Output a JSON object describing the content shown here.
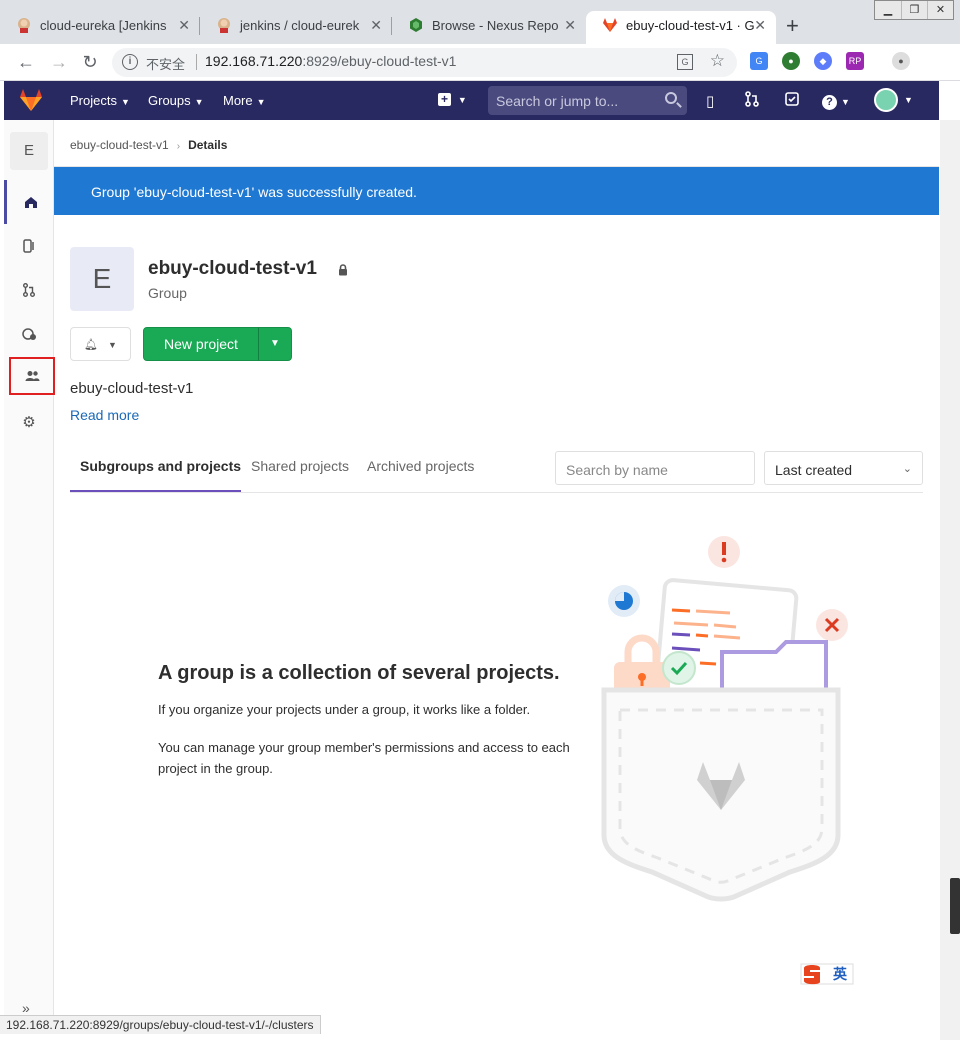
{
  "browser": {
    "tabs": [
      {
        "label": "cloud-eureka [Jenkins",
        "icon": "jenkins-icon"
      },
      {
        "label": "jenkins / cloud-eurek",
        "icon": "jenkins-icon"
      },
      {
        "label": "Browse - Nexus Repo",
        "icon": "nexus-icon"
      },
      {
        "label": "ebuy-cloud-test-v1 · G",
        "icon": "gitlab-icon",
        "active": true
      }
    ],
    "new_tab": "+",
    "security_label": "不安全",
    "url_host": "192.168.71.220",
    "url_rest": ":8929/ebuy-cloud-test-v1"
  },
  "gitlab_nav": {
    "projects": "Projects",
    "groups": "Groups",
    "more": "More",
    "search_placeholder": "Search or jump to..."
  },
  "sidebar": {
    "avatar_letter": "E",
    "items": [
      "home-icon",
      "issues-icon",
      "merge-requests-icon",
      "kubernetes-icon",
      "members-icon",
      "settings-icon"
    ],
    "collapse": "»"
  },
  "breadcrumb": {
    "group": "ebuy-cloud-test-v1",
    "current": "Details"
  },
  "flash": {
    "message": "Group 'ebuy-cloud-test-v1' was successfully created."
  },
  "group": {
    "avatar_letter": "E",
    "name": "ebuy-cloud-test-v1",
    "type": "Group",
    "description": "ebuy-cloud-test-v1",
    "read_more": "Read more"
  },
  "actions": {
    "new_project": "New project"
  },
  "tabs": {
    "subgroups": "Subgroups and projects",
    "shared": "Shared projects",
    "archived": "Archived projects"
  },
  "filter": {
    "search_placeholder": "Search by name",
    "sort_selected": "Last created"
  },
  "empty_state": {
    "title": "A group is a collection of several projects.",
    "p1": "If you organize your projects under a group, it works like a folder.",
    "p2": "You can manage your group member's permissions and access to each project in the group."
  },
  "ime": {
    "label": "英"
  },
  "status_bar": {
    "url": "192.168.71.220:8929/groups/ebuy-cloud-test-v1/-/clusters"
  },
  "colors": {
    "header": "#292961",
    "flash": "#1f78d1",
    "success": "#1aaa55",
    "link": "#1b69b6",
    "tab_underline": "#6b4fbb"
  }
}
